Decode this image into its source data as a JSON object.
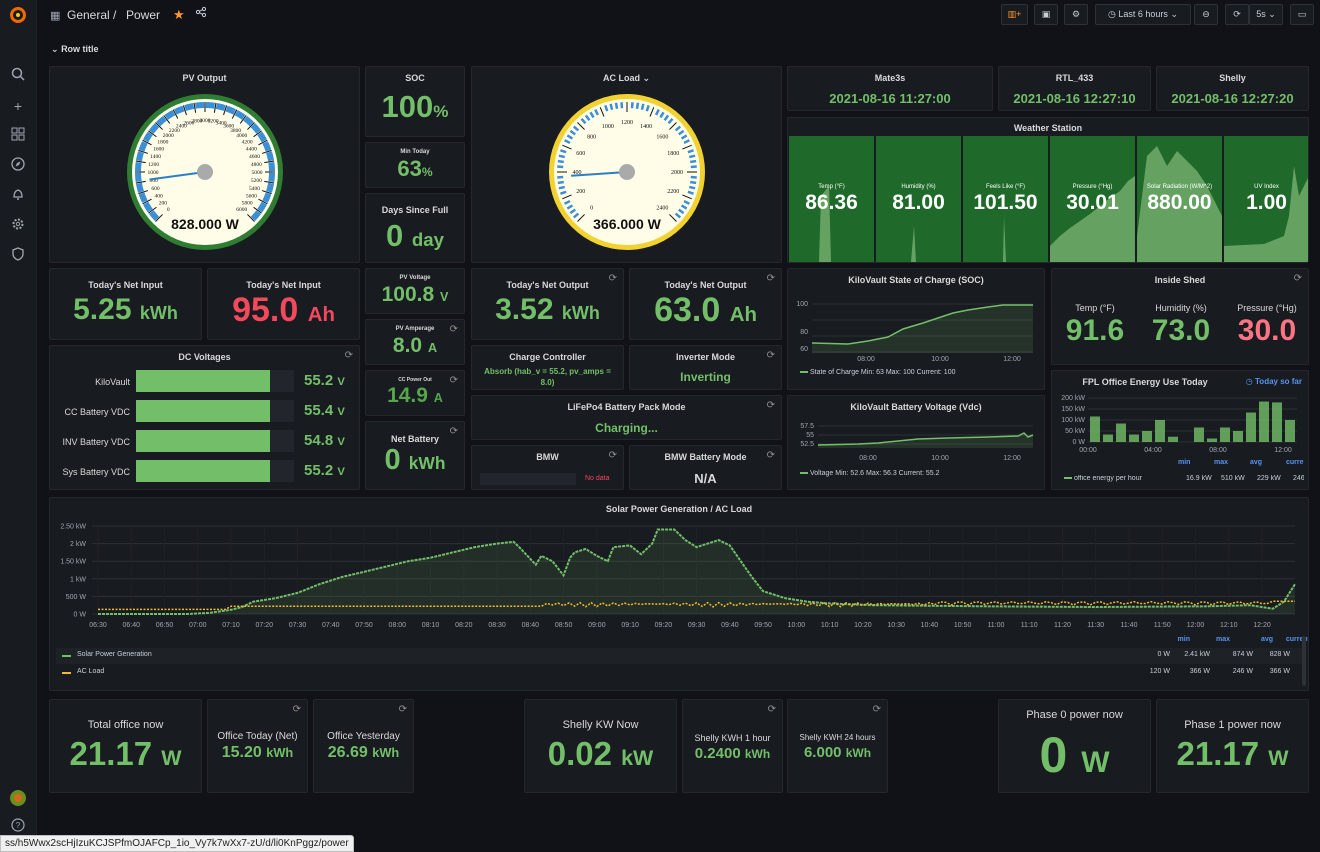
{
  "breadcrumb": {
    "folder": "General",
    "sep": "/",
    "title": "Power"
  },
  "toolbar": {
    "time_range": "Last 6 hours",
    "refresh": "5s"
  },
  "row_title": "Row title",
  "status_url": "ss/h5Wwx2scHjIzuKCJSPfmOJAFCp_1io_Vy7k7wXx7-zU/d/li0KnPggz/power",
  "pv_output": {
    "title": "PV Output",
    "value": "828.000 W",
    "ticks": [
      "0",
      "200",
      "400",
      "600",
      "800",
      "1000",
      "1200",
      "1400",
      "1600",
      "1800",
      "2000",
      "2200",
      "2400",
      "2600",
      "2800",
      "3000",
      "3200",
      "3400",
      "3600",
      "3800",
      "4000",
      "4200",
      "4400",
      "4600",
      "4800",
      "5000",
      "5200",
      "5400",
      "5600",
      "5800",
      "6000"
    ],
    "needle_fraction": 0.138
  },
  "soc": {
    "title": "SOC",
    "value": "100",
    "unit": "%"
  },
  "min_today": {
    "title": "Min Today",
    "value": "63",
    "unit": "%"
  },
  "days_since_full": {
    "title": "Days Since Full",
    "value": "0",
    "unit": "day"
  },
  "ac_load": {
    "title": "AC Load",
    "value": "366.000 W",
    "ticks": [
      "0",
      "200",
      "400",
      "600",
      "800",
      "1000",
      "1200",
      "1400",
      "1600",
      "1800",
      "2000",
      "2200",
      "2400"
    ],
    "needle_fraction": 0.1525
  },
  "mate3s": {
    "title": "Mate3s",
    "value": "2021-08-16 11:27:00"
  },
  "rtl433": {
    "title": "RTL_433",
    "value": "2021-08-16 12:27:10"
  },
  "shelly": {
    "title": "Shelly",
    "value": "2021-08-16 12:27:20"
  },
  "weather": {
    "title": "Weather Station",
    "cells": [
      {
        "label": "Temp (°F)",
        "value": "86.36"
      },
      {
        "label": "Humidity (%)",
        "value": "81.00"
      },
      {
        "label": "Feels Like (°F)",
        "value": "101.50"
      },
      {
        "label": "Pressure (°Hg)",
        "value": "30.01"
      },
      {
        "label": "Solar Radiation (W/M^2)",
        "value": "880.00"
      },
      {
        "label": "UV Index",
        "value": "1.00"
      }
    ]
  },
  "net_input_kwh": {
    "title": "Today's Net Input",
    "value": "5.25",
    "unit": "kWh"
  },
  "net_input_ah": {
    "title": "Today's Net Input",
    "value": "95.0",
    "unit": "Ah"
  },
  "pv_voltage": {
    "title": "PV Voltage",
    "value": "100.8",
    "unit": "V"
  },
  "net_output_kwh": {
    "title": "Today's Net Output",
    "value": "3.52",
    "unit": "kWh"
  },
  "net_output_ah": {
    "title": "Today's Net Output",
    "value": "63.0",
    "unit": "Ah"
  },
  "soc_chart": {
    "title": "KiloVault State of Charge (SOC)",
    "yticks": [
      "100",
      "80",
      "60"
    ],
    "xticks": [
      "08:00",
      "10:00",
      "12:00"
    ],
    "legend": "State of Charge  Min: 63  Max: 100  Current: 100"
  },
  "inside_shed": {
    "title": "Inside Shed",
    "items": [
      {
        "label": "Temp (°F)",
        "value": "91.6",
        "color": "#73bf69"
      },
      {
        "label": "Humidity (%)",
        "value": "73.0",
        "color": "#73bf69"
      },
      {
        "label": "Pressure (°Hg)",
        "value": "30.0",
        "color": "#ff7383"
      }
    ]
  },
  "dc_voltages": {
    "title": "DC Voltages",
    "rows": [
      {
        "label": "KiloVault",
        "value": "55.2",
        "unit": "V",
        "fill": 0.85
      },
      {
        "label": "CC Battery VDC",
        "value": "55.4",
        "unit": "V",
        "fill": 0.85
      },
      {
        "label": "INV Battery VDC",
        "value": "54.8",
        "unit": "V",
        "fill": 0.85
      },
      {
        "label": "Sys Battery VDC",
        "value": "55.2",
        "unit": "V",
        "fill": 0.85
      }
    ]
  },
  "pv_amperage": {
    "title": "PV Amperage",
    "value": "8.0",
    "unit": "A"
  },
  "charge_controller": {
    "title": "Charge Controller",
    "value": "Absorb (hab_v = 55.2, pv_amps = 8.0)"
  },
  "inverter_mode": {
    "title": "Inverter Mode",
    "value": "Inverting"
  },
  "cc_power_out": {
    "title": "CC Power Out",
    "value": "14.9",
    "unit": "A"
  },
  "lifepo4": {
    "title": "LiFePo4 Battery Pack Mode",
    "value": "Charging..."
  },
  "net_battery": {
    "title": "Net Battery",
    "value": "0",
    "unit": "kWh"
  },
  "bmw": {
    "title": "BMW",
    "value": "No data"
  },
  "bmw_mode": {
    "title": "BMW Battery Mode",
    "value": "N/A"
  },
  "voltage_chart": {
    "title": "KiloVault Battery Voltage (Vdc)",
    "yticks": [
      "57.5",
      "55",
      "52.5"
    ],
    "xticks": [
      "08:00",
      "10:00",
      "12:00"
    ],
    "legend": "Voltage  Min: 52.6  Max: 56.3  Current: 55.2"
  },
  "fpl": {
    "title": "FPL Office Energy Use Today",
    "link": "Today so far",
    "yticks": [
      "200 kW",
      "150 kW",
      "100 kW",
      "50 kW",
      "0 W"
    ],
    "xticks": [
      "00:00",
      "04:00",
      "08:00",
      "12:00"
    ],
    "headers": [
      "min",
      "max",
      "avg",
      "curre"
    ],
    "legend_name": "office energy per hour",
    "legend_vals": [
      "16.9 kW",
      "510 kW",
      "229 kW",
      "246"
    ],
    "bars": [
      0.58,
      0.17,
      0.42,
      0.17,
      0.25,
      0.5,
      0.12,
      0.0,
      0.33,
      0.08,
      0.33,
      0.25,
      0.67,
      0.92,
      0.9,
      0.5
    ]
  },
  "solar_chart": {
    "title": "Solar Power Generation / AC Load",
    "yticks": [
      "2.50 kW",
      "2 kW",
      "1.50 kW",
      "1 kW",
      "500 W",
      "0 W"
    ],
    "xticks": [
      "06:30",
      "06:40",
      "06:50",
      "07:00",
      "07:10",
      "07:20",
      "07:30",
      "07:40",
      "07:50",
      "08:00",
      "08:10",
      "08:20",
      "08:30",
      "08:40",
      "08:50",
      "09:00",
      "09:10",
      "09:20",
      "09:30",
      "09:40",
      "09:50",
      "10:00",
      "10:10",
      "10:20",
      "10:30",
      "10:40",
      "10:50",
      "11:00",
      "11:10",
      "11:20",
      "11:30",
      "11:40",
      "11:50",
      "12:00",
      "12:10",
      "12:20"
    ],
    "headers": [
      "min",
      "max",
      "avg",
      "current"
    ],
    "series": [
      {
        "name": "Solar Power Generation",
        "color": "#73bf69",
        "stats": [
          "0 W",
          "2.41 kW",
          "874 W",
          "828 W"
        ]
      },
      {
        "name": "AC Load",
        "color": "#f2b92c",
        "stats": [
          "120 W",
          "366 W",
          "246 W",
          "366 W"
        ]
      }
    ]
  },
  "total_office": {
    "title": "Total office now",
    "value": "21.17",
    "unit": "W"
  },
  "office_today": {
    "title": "Office Today (Net)",
    "value": "15.20",
    "unit": "kWh"
  },
  "office_yesterday": {
    "title": "Office Yesterday",
    "value": "26.69",
    "unit": "kWh"
  },
  "shelly_kw": {
    "title": "Shelly KW Now",
    "value": "0.02",
    "unit": "kW"
  },
  "shelly_kwh_1h": {
    "title": "Shelly KWH 1 hour",
    "value": "0.2400",
    "unit": "kWh"
  },
  "shelly_kwh_24h": {
    "title": "Shelly KWH 24 hours",
    "value": "6.000",
    "unit": "kWh"
  },
  "phase0": {
    "title": "Phase 0 power now",
    "value": "0",
    "unit": "W"
  },
  "phase1": {
    "title": "Phase 1 power now",
    "value": "21.17",
    "unit": "W"
  },
  "colors": {
    "green": "#73bf69",
    "red": "#f2495c",
    "yellow": "#f2b92c",
    "blue": "#3274d9"
  }
}
